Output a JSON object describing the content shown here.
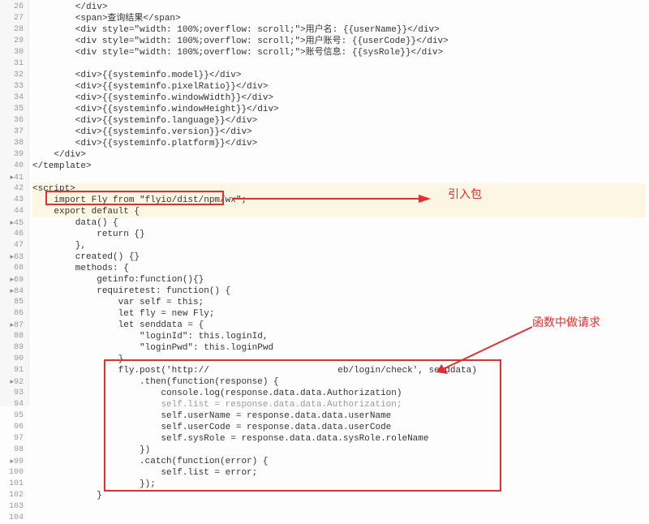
{
  "annotations": {
    "import_box_label": "引入包",
    "request_box_label": "函数中做请求"
  },
  "lines": {
    "l26": "        </div>",
    "l27": "        <span>查询结果</span>",
    "l28": "        <div style=\"width: 100%;overflow: scroll;\">用户名: {{userName}}</div>",
    "l29": "        <div style=\"width: 100%;overflow: scroll;\">用户账号: {{userCode}}</div>",
    "l30": "        <div style=\"width: 100%;overflow: scroll;\">账号信息: {{sysRole}}</div>",
    "l31": "",
    "l32": "        <div>{{systeminfo.model}}</div>",
    "l33": "        <div>{{systeminfo.pixelRatio}}</div>",
    "l34": "        <div>{{systeminfo.windowWidth}}</div>",
    "l35": "        <div>{{systeminfo.windowHeight}}</div>",
    "l36": "        <div>{{systeminfo.language}}</div>",
    "l37": "        <div>{{systeminfo.version}}</div>",
    "l38": "        <div>{{systeminfo.platform}}</div>",
    "l39": "    </div>",
    "l40": "</template>",
    "l41": "",
    "l42": "<script>",
    "l43": "    import Fly from \"flyio/dist/npm/wx\";",
    "l44": "    export default {",
    "l45": "        data() {",
    "l46": "            return {}",
    "l47": "        },",
    "l48": "        created() {}",
    "l49": "        methods: {",
    "l50": "            getinfo:function(){}",
    "l51": "            requiretest: function() {",
    "l52": "                var self = this;",
    "l53": "                let fly = new Fly;",
    "l54": "                let senddata = {",
    "l55": "                    \"loginId\": this.loginId,",
    "l56": "                    \"loginPwd\": this.loginPwd",
    "l57": "                }",
    "l58": "                fly.post('http://                        eb/login/check', senddata)",
    "l59": "                    .then(function(response) {",
    "l60": "                        console.log(response.data.data.Authorization)",
    "l61": "                        self.list = response.data.data.Authorization;",
    "l62": "                        self.userName = response.data.data.userName",
    "l63": "                        self.userCode = response.data.data.userCode",
    "l64": "                        self.sysRole = response.data.data.sysRole.roleName",
    "l65": "                    })",
    "l66": "                    .catch(function(error) {",
    "l67": "                        self.list = error;",
    "l68": "                    });",
    "l69": "            }",
    "l70": "",
    "l71": ""
  },
  "gutter": [
    "26",
    "27",
    "28",
    "29",
    "30",
    "31",
    "32",
    "33",
    "34",
    "35",
    "36",
    "37",
    "38",
    "39",
    "40",
    "41",
    "42",
    "43",
    "44",
    "45",
    "46",
    "47",
    "63",
    "68",
    "69",
    "84",
    "85",
    "86",
    "87",
    "88",
    "89",
    "90",
    "91",
    "92",
    "93",
    "94",
    "95",
    "96",
    "97",
    "98",
    "99",
    "100",
    "101",
    "102",
    "103",
    "104"
  ]
}
